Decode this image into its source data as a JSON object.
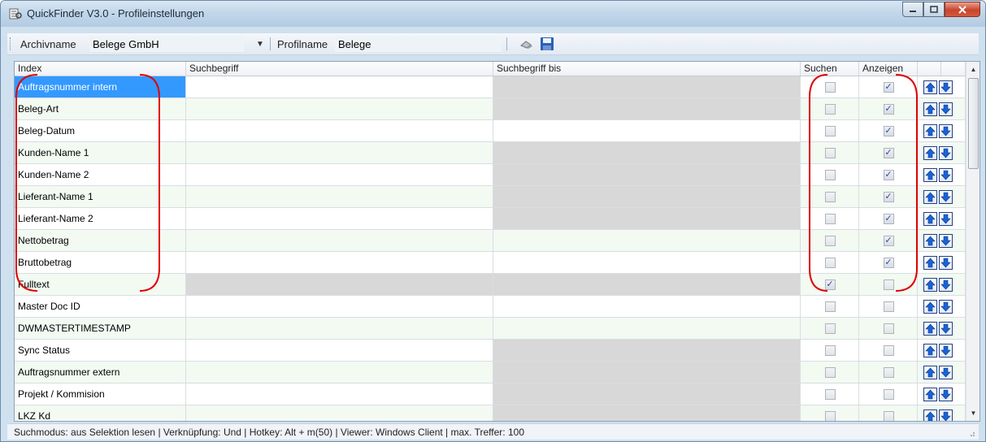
{
  "window": {
    "title": "QuickFinder V3.0 - Profileinstellungen",
    "icon": "app-icon",
    "controls": [
      "minimize-icon",
      "maximize-icon",
      "close-icon"
    ]
  },
  "toolbar": {
    "archive_label": "Archivname",
    "archive_value": "Belege GmbH",
    "profile_label": "Profilname",
    "profile_value": "Belege"
  },
  "table": {
    "columns": [
      "Index",
      "Suchbegriff",
      "Suchbegriff bis",
      "Suchen",
      "Anzeigen",
      ""
    ],
    "rows": [
      {
        "index": "Auftragsnummer intern",
        "range_disabled": true,
        "suchen": false,
        "anzeigen": true,
        "selected": true
      },
      {
        "index": "Beleg-Art",
        "range_disabled": true,
        "suchen": false,
        "anzeigen": true
      },
      {
        "index": "Beleg-Datum",
        "range_disabled": false,
        "suchen": false,
        "anzeigen": true
      },
      {
        "index": "Kunden-Name 1",
        "range_disabled": true,
        "suchen": false,
        "anzeigen": true
      },
      {
        "index": "Kunden-Name 2",
        "range_disabled": true,
        "suchen": false,
        "anzeigen": true
      },
      {
        "index": "Lieferant-Name 1",
        "range_disabled": true,
        "suchen": false,
        "anzeigen": true
      },
      {
        "index": "Lieferant-Name 2",
        "range_disabled": true,
        "suchen": false,
        "anzeigen": true
      },
      {
        "index": "Nettobetrag",
        "range_disabled": false,
        "suchen": false,
        "anzeigen": true
      },
      {
        "index": "Bruttobetrag",
        "range_disabled": false,
        "suchen": false,
        "anzeigen": true
      },
      {
        "index": "Fulltext",
        "range_disabled": true,
        "term_disabled": true,
        "suchen": true,
        "anzeigen": false
      },
      {
        "index": "Master Doc ID",
        "range_disabled": false,
        "suchen": false,
        "anzeigen": false
      },
      {
        "index": "DWMASTERTIMESTAMP",
        "range_disabled": false,
        "suchen": false,
        "anzeigen": false
      },
      {
        "index": "Sync Status",
        "range_disabled": true,
        "suchen": false,
        "anzeigen": false
      },
      {
        "index": "Auftragsnummer extern",
        "range_disabled": true,
        "suchen": false,
        "anzeigen": false
      },
      {
        "index": "Projekt / Kommision",
        "range_disabled": true,
        "suchen": false,
        "anzeigen": false
      },
      {
        "index": "LKZ Kd",
        "range_disabled": true,
        "suchen": false,
        "anzeigen": false
      }
    ]
  },
  "statusbar": {
    "text": "Suchmodus:  aus Selektion lesen  |  Verknüpfung:  Und  |  Hotkey:  Alt + m(50)  |  Viewer:  Windows Client  |  max. Treffer:  100"
  },
  "colors": {
    "selection": "#3399ff",
    "alt_row": "#f2faf2",
    "disabled_cell": "#d8d8d8",
    "annotation": "#e00000",
    "arrow_blue": "#1a63d6"
  }
}
